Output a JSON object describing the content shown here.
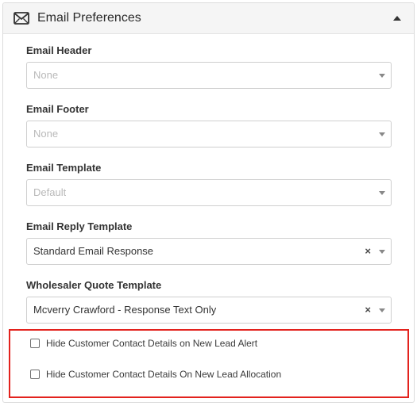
{
  "panel": {
    "title": "Email Preferences",
    "icon": "envelope-icon",
    "collapse_icon": "caret-up-icon"
  },
  "fields": {
    "email_header": {
      "label": "Email Header",
      "value": "None",
      "is_placeholder": true
    },
    "email_footer": {
      "label": "Email Footer",
      "value": "None",
      "is_placeholder": true
    },
    "email_template": {
      "label": "Email Template",
      "value": "Default",
      "is_placeholder": true
    },
    "email_reply_template": {
      "label": "Email Reply Template",
      "value": "Standard Email Response",
      "is_placeholder": false,
      "clear_glyph": "×"
    },
    "wholesaler_quote_template": {
      "label": "Wholesaler Quote Template",
      "value": "Mcverry Crawford - Response Text Only",
      "is_placeholder": false,
      "clear_glyph": "×"
    }
  },
  "checkboxes": [
    {
      "label": "Hide Customer Contact Details on New Lead Alert",
      "checked": false
    },
    {
      "label": "Hide Customer Contact Details On New Lead Allocation",
      "checked": false
    }
  ],
  "colors": {
    "highlight_border": "#e3221d",
    "header_background": "#f5f5f5",
    "placeholder_text": "#b9b9b9"
  }
}
